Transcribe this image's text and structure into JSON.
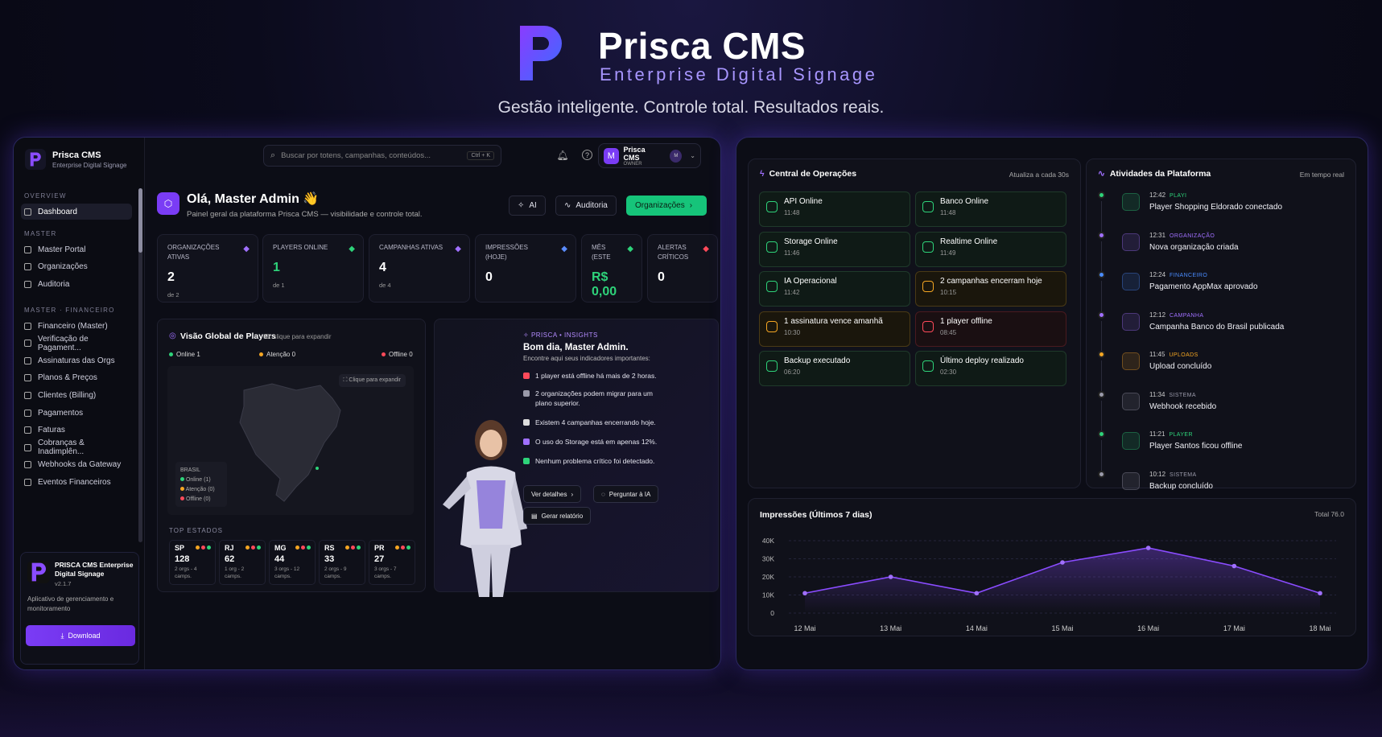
{
  "hero": {
    "title": "Prisca CMS",
    "subtitle": "Enterprise Digital Signage",
    "tagline": "Gestão inteligente. Controle total. Resultados reais."
  },
  "brand": {
    "accent": "#7a3cf5",
    "green": "#16c47a"
  },
  "sidebar": {
    "brand_name": "Prisca CMS",
    "brand_sub": "Enterprise Digital Signage",
    "sections": [
      {
        "label": "OVERVIEW",
        "items": [
          {
            "label": "Dashboard",
            "icon": "grid-icon",
            "active": true
          }
        ]
      },
      {
        "label": "MASTER",
        "items": [
          {
            "label": "Master Portal",
            "icon": "portal-icon"
          },
          {
            "label": "Organizações",
            "icon": "building-icon"
          },
          {
            "label": "Auditoria",
            "icon": "audit-icon"
          }
        ]
      },
      {
        "label": "MASTER · FINANCEIRO",
        "items": [
          {
            "label": "Financeiro (Master)",
            "icon": "finance-icon"
          },
          {
            "label": "Verificação de Pagament...",
            "icon": "verify-icon"
          },
          {
            "label": "Assinaturas das Orgs",
            "icon": "subscription-icon"
          },
          {
            "label": "Planos & Preços",
            "icon": "plans-icon"
          },
          {
            "label": "Clientes (Billing)",
            "icon": "clients-icon"
          },
          {
            "label": "Pagamentos",
            "icon": "payments-icon"
          },
          {
            "label": "Faturas",
            "icon": "invoice-icon"
          },
          {
            "label": "Cobranças & Inadimplên...",
            "icon": "billing-icon"
          },
          {
            "label": "Webhooks da Gateway",
            "icon": "webhook-icon"
          },
          {
            "label": "Eventos Financeiros",
            "icon": "events-icon"
          }
        ]
      }
    ],
    "app_card": {
      "name": "PRISCA CMS Enterprise Digital Signage",
      "version": "v2.1.7",
      "desc": "Aplicativo de gerenciamento e monitoramento",
      "download": "Download"
    }
  },
  "topbar": {
    "search_placeholder": "Buscar por totens, campanhas, conteúdos...",
    "shortcut": "Ctrl + K",
    "user_name": "Prisca CMS",
    "user_role": "OWNER",
    "avatar": "M",
    "avatar2": "M"
  },
  "greeting": {
    "title": "Olá, Master Admin 👋",
    "subtitle": "Painel geral da plataforma Prisca CMS — visibilidade e controle total.",
    "btn_ai": "AI",
    "btn_audit": "Auditoria",
    "btn_orgs": "Organizações"
  },
  "stats": [
    {
      "label": "ORGANIZAÇÕES ATIVAS",
      "value": "2",
      "sub": "de 2",
      "icon": "org-icon",
      "color": "#a070ff"
    },
    {
      "label": "PLAYERS ONLINE",
      "value": "1",
      "sub": "de 1",
      "icon": "player-icon",
      "color": "#2ed37a",
      "green": true
    },
    {
      "label": "CAMPANHAS ATIVAS",
      "value": "4",
      "sub": "de 4",
      "icon": "megaphone-icon",
      "color": "#a070ff"
    },
    {
      "label": "IMPRESSÕES (HOJE)",
      "value": "0",
      "sub": "",
      "icon": "eye-icon",
      "color": "#5a8cff"
    },
    {
      "label": "MÊS (ESTE",
      "value": "R$ 0,00",
      "sub": "",
      "icon": "dollar-icon",
      "color": "#2ed37a",
      "green": true
    },
    {
      "label": "ALERTAS CRÍTICOS",
      "value": "0",
      "sub": "",
      "icon": "alert-icon",
      "color": "#ff4a5a"
    }
  ],
  "map": {
    "title": "Visão Global de Players",
    "id_hint": "ID: clique para expandir",
    "legend": [
      {
        "label": "Online 1",
        "color": "#2ed37a"
      },
      {
        "label": "Atenção 0",
        "color": "#f5a623"
      },
      {
        "label": "Offline 0",
        "color": "#ff4a5a"
      }
    ],
    "expand": "Clique para expandir",
    "box_title": "BRASIL",
    "box_items": [
      {
        "label": "Online (1)",
        "color": "#2ed37a"
      },
      {
        "label": "Atenção (0)",
        "color": "#f5a623"
      },
      {
        "label": "Offline (0)",
        "color": "#ff4a5a"
      }
    ],
    "top_label": "TOP ESTADOS",
    "states": [
      {
        "uf": "SP",
        "n": "128",
        "d": "2 orgs - 4 camps."
      },
      {
        "uf": "RJ",
        "n": "62",
        "d": "1 org - 2 camps."
      },
      {
        "uf": "MG",
        "n": "44",
        "d": "3 orgs - 12 camps."
      },
      {
        "uf": "RS",
        "n": "33",
        "d": "2 orgs - 9 camps."
      },
      {
        "uf": "PR",
        "n": "27",
        "d": "3 orgs - 7 camps."
      }
    ]
  },
  "insights": {
    "brand": "PRISCA • INSIGHTS",
    "title": "Bom dia, Master Admin.",
    "subtitle": "Encontre aqui seus indicadores importantes:",
    "items": [
      {
        "text": "1 player está offline há mais de 2 horas.",
        "color": "#ff4a5a"
      },
      {
        "text": "2 organizações podem migrar para um plano superior.",
        "color": "#9a9aaa"
      },
      {
        "text": "Existem 4 campanhas encerrando hoje.",
        "color": "#dddddd"
      },
      {
        "text": "O uso do Storage está em apenas 12%.",
        "color": "#a070ff"
      },
      {
        "text": "Nenhum problema crítico foi detectado.",
        "color": "#2ed37a"
      }
    ],
    "btn_details": "Ver detalhes",
    "btn_ask": "Perguntar à IA",
    "btn_report": "Gerar relatório"
  },
  "ops": {
    "title": "Central de Operações",
    "refresh": "Atualiza a cada 30s",
    "items": [
      {
        "t": "API Online",
        "tm": "11:48",
        "kind": "ok"
      },
      {
        "t": "Banco Online",
        "tm": "11:48",
        "kind": "ok"
      },
      {
        "t": "Storage Online",
        "tm": "11:46",
        "kind": "ok"
      },
      {
        "t": "Realtime Online",
        "tm": "11:49",
        "kind": "ok"
      },
      {
        "t": "IA Operacional",
        "tm": "11:42",
        "kind": "ok"
      },
      {
        "t": "2 campanhas encerram hoje",
        "tm": "10:15",
        "kind": "warn"
      },
      {
        "t": "1 assinatura vence amanhã",
        "tm": "10:30",
        "kind": "warn"
      },
      {
        "t": "1 player offline",
        "tm": "08:45",
        "kind": "err"
      },
      {
        "t": "Backup executado",
        "tm": "06:20",
        "kind": "ok"
      },
      {
        "t": "Último deploy realizado",
        "tm": "02:30",
        "kind": "ok"
      }
    ]
  },
  "activity": {
    "title": "Atividades da Plataforma",
    "live": "Em tempo real",
    "items": [
      {
        "time": "12:42",
        "tag": "PLAYI",
        "text": "Player Shopping Eldorado conectado",
        "color": "#2ed37a"
      },
      {
        "time": "12:31",
        "tag": "ORGANIZAÇÃO",
        "text": "Nova organização criada",
        "color": "#a070ff"
      },
      {
        "time": "12:24",
        "tag": "FINANCEIRO",
        "text": "Pagamento AppMax aprovado",
        "color": "#4a8cff"
      },
      {
        "time": "12:12",
        "tag": "CAMPANHA",
        "text": "Campanha Banco do Brasil publicada",
        "color": "#a070ff"
      },
      {
        "time": "11:45",
        "tag": "UPLOADS",
        "text": "Upload concluído",
        "color": "#f5a623"
      },
      {
        "time": "11:34",
        "tag": "SISTEMA",
        "text": "Webhook recebido",
        "color": "#9a9aaa"
      },
      {
        "time": "11:21",
        "tag": "PLAYER",
        "text": "Player Santos ficou offline",
        "color": "#2ed37a"
      },
      {
        "time": "10:12",
        "tag": "SISTEMA",
        "text": "Backup concluído",
        "color": "#9a9aaa"
      }
    ]
  },
  "chart_data": {
    "type": "area",
    "title": "Impressões (Últimos 7 dias)",
    "total_label": "Total 76.0",
    "categories": [
      "12 Mai",
      "13 Mai",
      "14 Mai",
      "15 Mai",
      "16 Mai",
      "17 Mai",
      "18 Mai"
    ],
    "values": [
      11000,
      20000,
      11000,
      28000,
      36000,
      26000,
      11000
    ],
    "yticks": [
      "40K",
      "30K",
      "20K",
      "10K",
      "0"
    ],
    "ylim": [
      0,
      40000
    ],
    "grid": true,
    "color": "#8a4cff"
  }
}
